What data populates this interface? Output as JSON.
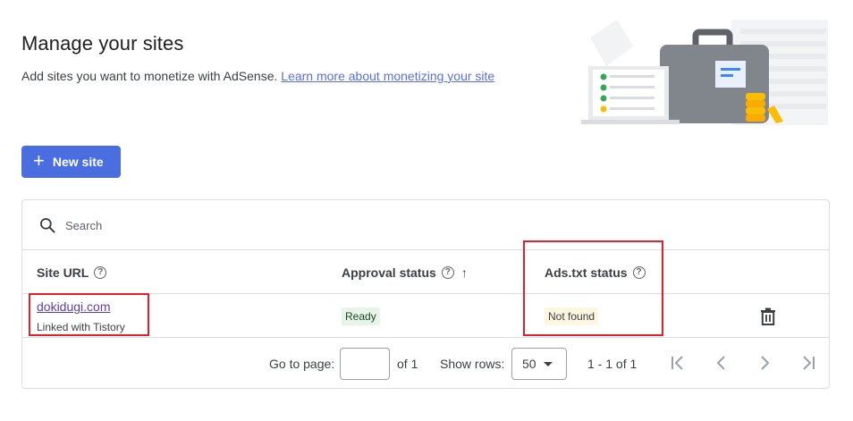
{
  "page": {
    "title": "Manage your sites",
    "subtitle": "Add sites you want to monetize with AdSense.",
    "learn_more_link": "Learn more about monetizing your site"
  },
  "toolbar": {
    "new_site_label": "New site"
  },
  "search": {
    "placeholder": "Search"
  },
  "table": {
    "columns": [
      {
        "label": "Site URL"
      },
      {
        "label": "Approval status"
      },
      {
        "label": "Ads.txt status"
      }
    ],
    "rows": [
      {
        "site_url": "dokidugi.com",
        "site_note": "Linked with Tistory",
        "approval_status": "Ready",
        "ads_txt_status": "Not found"
      }
    ]
  },
  "pagination": {
    "goto_label": "Go to page:",
    "of_label": "of 1",
    "rows_label": "Show rows:",
    "rows_value": "50",
    "range": "1 - 1 of 1"
  },
  "icons": [
    "search-icon",
    "help-icon",
    "sort-up-icon",
    "delete-icon",
    "first-page-icon",
    "prev-page-icon",
    "next-page-icon",
    "last-page-icon"
  ],
  "colors": {
    "primary": "#4a6ee0",
    "link": "#5b6ee1",
    "visited_link": "#5b3fae",
    "ready_chip_bg": "#e6f4ea",
    "notfound_chip_bg": "#fef7e0",
    "annotation": "#e0202a"
  }
}
